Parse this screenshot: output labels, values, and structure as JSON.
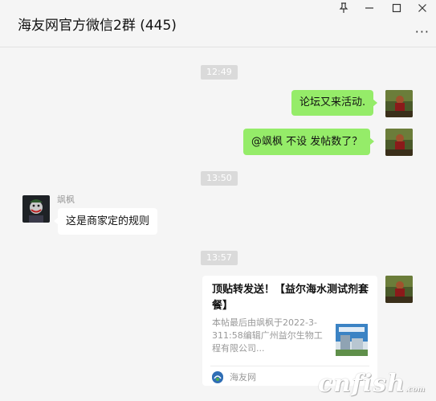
{
  "window": {
    "title": "海友网官方微信2群 (445)",
    "controls": {
      "pin_icon": "pin-icon",
      "minimize_icon": "minimize-icon",
      "maximize_icon": "maximize-icon",
      "close_icon": "close-icon"
    },
    "more_label": "···"
  },
  "messages": [
    {
      "type": "time",
      "text": "12:49"
    },
    {
      "type": "text",
      "from": "me",
      "text": "论坛又来活动."
    },
    {
      "type": "text",
      "from": "me",
      "text": "@飒枫 不设 发帖数了？"
    },
    {
      "type": "time",
      "text": "13:50"
    },
    {
      "type": "text",
      "from": "other",
      "sender": "飒枫",
      "text": "这是商家定的规则"
    },
    {
      "type": "time",
      "text": "13:57"
    },
    {
      "type": "link_card",
      "from": "me",
      "title": "顶贴转发送！【益尔海水测试剂套餐】",
      "description": "本帖最后由飒枫于2022-3-311:58编辑广州益尔生物工程有限公司...",
      "thumbnail_icon": "article-thumbnail-image",
      "source": "海友网",
      "source_icon": "haiyouwang-logo-icon"
    }
  ],
  "watermark": {
    "text": "cnfish",
    "suffix": ".com"
  },
  "colors": {
    "my_bubble": "#95ec69",
    "other_bubble": "#ffffff",
    "background": "#f5f5f5",
    "time_badge": "#dadada"
  }
}
